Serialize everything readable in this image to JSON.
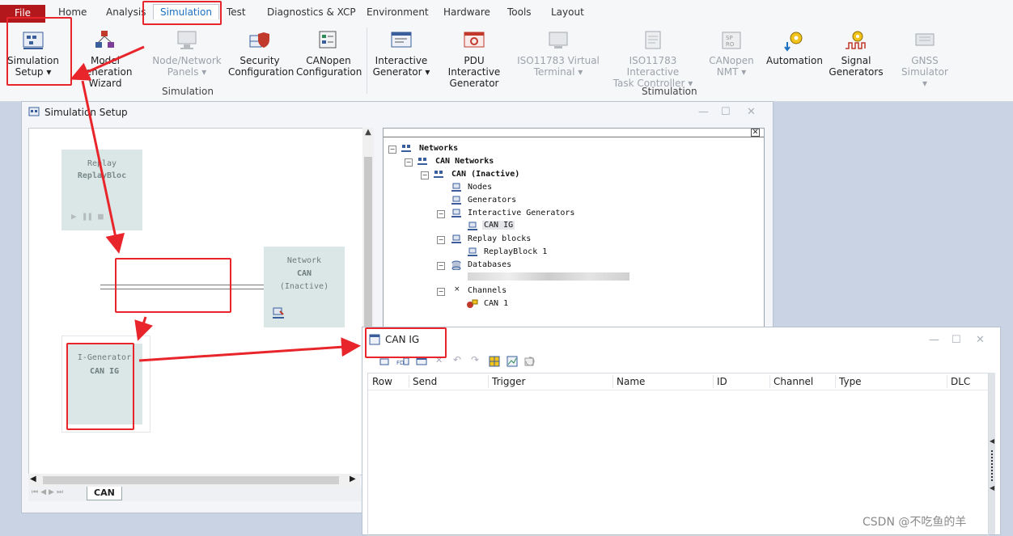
{
  "menu_tabs": [
    "Home",
    "Analysis",
    "Simulation",
    "Test",
    "Diagnostics & XCP",
    "Environment",
    "Hardware",
    "Tools",
    "Layout"
  ],
  "file_tab": "File",
  "ribbon": {
    "simulation_setup": [
      "Simulation",
      "Setup"
    ],
    "model_generation": [
      "Model Generation",
      "Wizard"
    ],
    "node_network_panels": [
      "Node/Network",
      "Panels"
    ],
    "security_config": [
      "Security",
      "Configuration"
    ],
    "canopen_config": [
      "CANopen",
      "Configuration"
    ],
    "interactive_generator": [
      "Interactive",
      "Generator"
    ],
    "pdu_interactive": [
      "PDU Interactive",
      "Generator"
    ],
    "iso_virtual_terminal": [
      "ISO11783 Virtual",
      "Terminal"
    ],
    "iso_task_controller": [
      "ISO11783 Interactive",
      "Task Controller"
    ],
    "canopen_nmt": [
      "CANopen",
      "NMT"
    ],
    "automation": "Automation",
    "signal_generators": [
      "Signal",
      "Generators"
    ],
    "gnss_simulator": "GNSS Simulator",
    "group_simulation": "Simulation",
    "group_stimulation": "Stimulation"
  },
  "sim_setup_window": {
    "title": "Simulation Setup",
    "replay_block": {
      "label": "Replay",
      "name": "ReplayBloc"
    },
    "network_block": {
      "label": "Network",
      "name": "CAN",
      "state": "(Inactive)"
    },
    "igen_block": {
      "label": "I-Generator",
      "name": "CAN IG"
    },
    "bottom_tab": "CAN"
  },
  "tree": {
    "networks": "Networks",
    "can_networks": "CAN Networks",
    "can_inactive": "CAN (Inactive)",
    "nodes": "Nodes",
    "generators": "Generators",
    "interactive_generators": "Interactive Generators",
    "can_ig": "CAN IG",
    "replay_blocks": "Replay blocks",
    "replay_block_1": "ReplayBlock 1",
    "databases": "Databases",
    "channels": "Channels",
    "can_1": "CAN 1"
  },
  "can_ig_window": {
    "title": "CAN IG",
    "columns": [
      "Row",
      "Send",
      "Trigger",
      "Name",
      "ID",
      "Channel",
      "Type",
      "DLC"
    ]
  },
  "watermark": "CSDN @不吃鱼的羊",
  "colors": {
    "accent_red": "#e8252a",
    "file_tab": "#b3181d",
    "block_bg": "#dbe7e7"
  }
}
